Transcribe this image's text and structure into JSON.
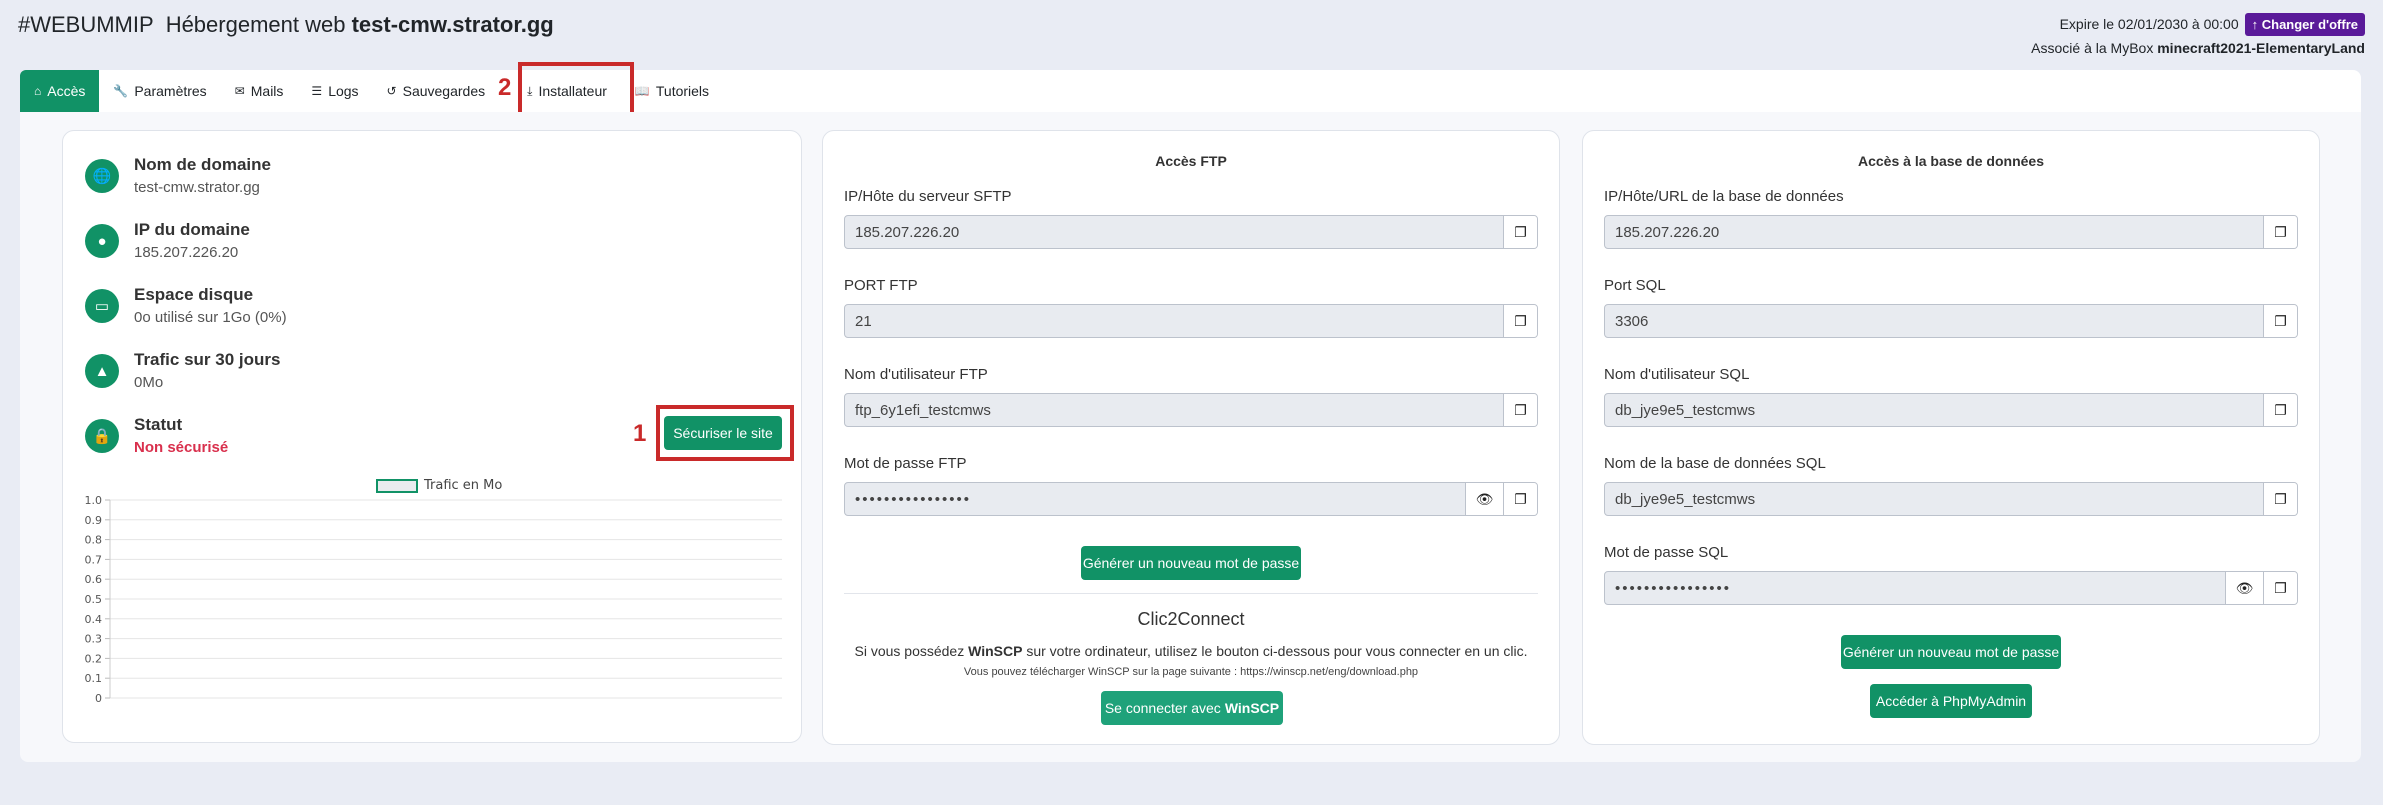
{
  "header": {
    "hash_brand": "#WEBUMMIP",
    "title_prefix": "Hébergement web",
    "domain": "test-cmw.strator.gg",
    "expiry_text": "Expire le 02/01/2030 à 00:00",
    "change_offer_label": "Changer d'offre",
    "mybox_prefix": "Associé à la MyBox",
    "mybox_name": "minecraft2021-ElementaryLand"
  },
  "tabs": [
    {
      "label": "Accès",
      "icon": "home-icon",
      "active": true
    },
    {
      "label": "Paramètres",
      "icon": "wrench-icon"
    },
    {
      "label": "Mails",
      "icon": "envelope-icon"
    },
    {
      "label": "Logs",
      "icon": "list-icon"
    },
    {
      "label": "Sauvegardes",
      "icon": "history-icon"
    },
    {
      "label": "Installateur",
      "icon": "download-icon"
    },
    {
      "label": "Tutoriels",
      "icon": "book-icon"
    }
  ],
  "callouts": {
    "one": "1",
    "two": "2"
  },
  "info": {
    "domain_label": "Nom de domaine",
    "domain_value": "test-cmw.strator.gg",
    "ip_label": "IP du domaine",
    "ip_value": "185.207.226.20",
    "disk_label": "Espace disque",
    "disk_value": "0o utilisé sur 1Go (0%)",
    "traffic_label": "Trafic sur 30 jours",
    "traffic_value": "0Mo",
    "status_label": "Statut",
    "status_value": "Non sécurisé",
    "secure_button": "Sécuriser le site"
  },
  "chart_data": {
    "type": "line",
    "series": [
      {
        "name": "Trafic en Mo",
        "values": []
      }
    ],
    "y_ticks": [
      "0",
      "0.1",
      "0.2",
      "0.3",
      "0.4",
      "0.5",
      "0.6",
      "0.7",
      "0.8",
      "0.9",
      "1.0"
    ],
    "ylim": [
      0,
      1.0
    ],
    "grid": true,
    "legend": "top-center"
  },
  "ftp": {
    "title": "Accès FTP",
    "host_label": "IP/Hôte du serveur SFTP",
    "host_value": "185.207.226.20",
    "port_label": "PORT FTP",
    "port_value": "21",
    "user_label": "Nom d'utilisateur FTP",
    "user_value": "ftp_6y1efi_testcmws",
    "pass_label": "Mot de passe FTP",
    "pass_value": "••••••••••••••••",
    "gen_button": "Générer un nouveau mot de passe",
    "c2c_title": "Clic2Connect",
    "c2c_text_1": "Si vous possédez",
    "c2c_text_bold": "WinSCP",
    "c2c_text_2": "sur votre ordinateur, utilisez le bouton ci-dessous pour vous connecter en un clic.",
    "c2c_small": "Vous pouvez télécharger WinSCP sur la page suivante : https://winscp.net/eng/download.php",
    "connect_button": "Se connecter avec",
    "connect_button_bold": "WinSCP"
  },
  "db": {
    "title": "Accès à la base de données",
    "host_label": "IP/Hôte/URL de la base de données",
    "host_value": "185.207.226.20",
    "port_label": "Port SQL",
    "port_value": "3306",
    "user_label": "Nom d'utilisateur SQL",
    "user_value": "db_jye9e5_testcmws",
    "dbname_label": "Nom de la base de données SQL",
    "dbname_value": "db_jye9e5_testcmws",
    "pass_label": "Mot de passe SQL",
    "pass_value": "••••••••••••••••",
    "gen_button": "Générer un nouveau mot de passe",
    "pma_button": "Accéder à PhpMyAdmin"
  },
  "colors": {
    "accent": "#119266",
    "purple": "#5a1a99",
    "alert": "#c92a2a",
    "status_red": "#d9304d"
  }
}
